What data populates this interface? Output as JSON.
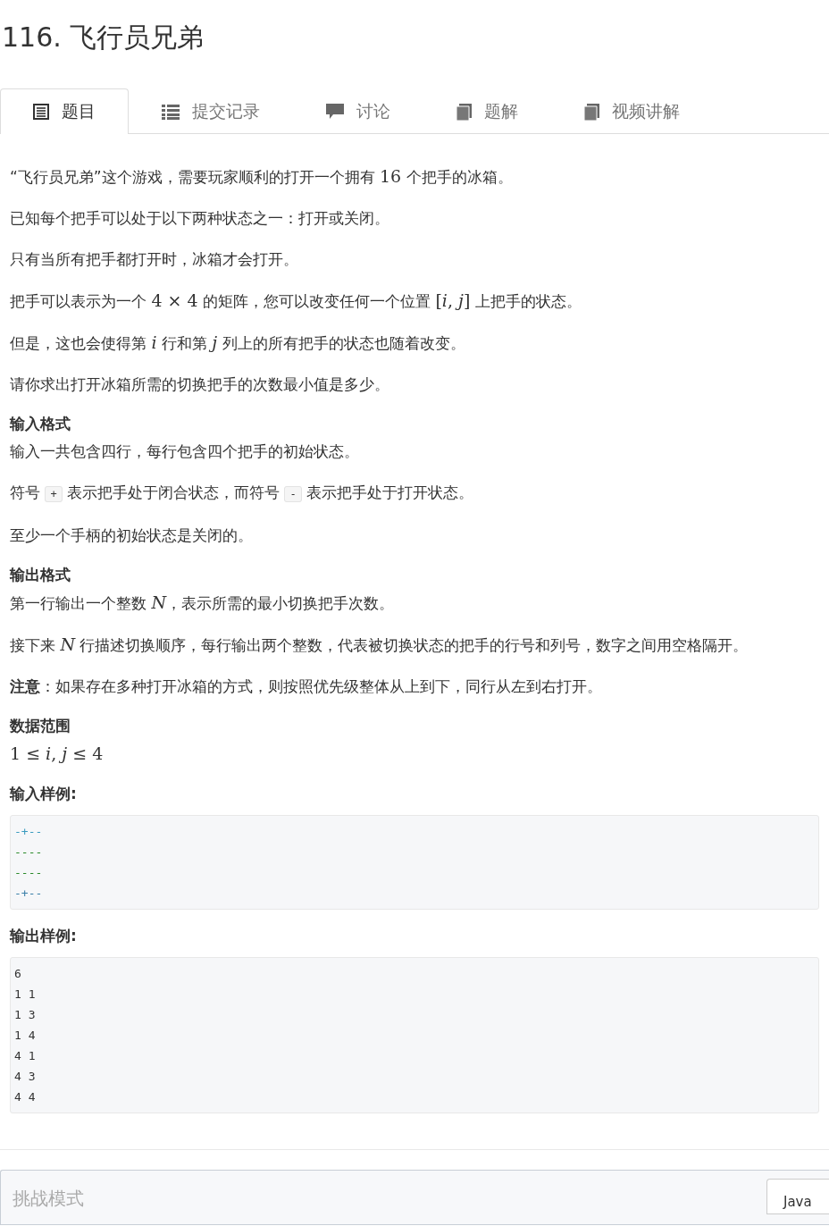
{
  "title": "116. 飞行员兄弟",
  "tabs": [
    {
      "label": "题目",
      "selected": true
    },
    {
      "label": "提交记录",
      "selected": false
    },
    {
      "label": "讨论",
      "selected": false
    },
    {
      "label": "题解",
      "selected": false
    },
    {
      "label": "视频讲解",
      "selected": false
    }
  ],
  "blocks": [
    {
      "kind": "para",
      "segments": [
        {
          "kind": "text",
          "text": "“飞行员兄弟”这个游戏，需要玩家顺利的打开一个拥有 "
        },
        {
          "kind": "math",
          "text": "16"
        },
        {
          "kind": "text",
          "text": " 个把手的冰箱。"
        }
      ]
    },
    {
      "kind": "para",
      "segments": [
        {
          "kind": "text",
          "text": "已知每个把手可以处于以下两种状态之一：打开或关闭。"
        }
      ]
    },
    {
      "kind": "para",
      "segments": [
        {
          "kind": "text",
          "text": "只有当所有把手都打开时，冰箱才会打开。"
        }
      ]
    },
    {
      "kind": "para",
      "segments": [
        {
          "kind": "text",
          "text": "把手可以表示为一个 "
        },
        {
          "kind": "math",
          "text": "4 × 4"
        },
        {
          "kind": "text",
          "text": " 的矩阵，您可以改变任何一个位置 "
        },
        {
          "kind": "math",
          "text": "[*i*, *j*]"
        },
        {
          "kind": "text",
          "text": " 上把手的状态。"
        }
      ]
    },
    {
      "kind": "para",
      "segments": [
        {
          "kind": "text",
          "text": "但是，这也会使得第 "
        },
        {
          "kind": "math",
          "text": "*i*"
        },
        {
          "kind": "text",
          "text": " 行和第 "
        },
        {
          "kind": "math",
          "text": "*j*"
        },
        {
          "kind": "text",
          "text": " 列上的所有把手的状态也随着改变。"
        }
      ]
    },
    {
      "kind": "para",
      "segments": [
        {
          "kind": "text",
          "text": "请你求出打开冰箱所需的切换把手的次数最小值是多少。"
        }
      ]
    },
    {
      "kind": "heading",
      "text": "输入格式"
    },
    {
      "kind": "para",
      "segments": [
        {
          "kind": "text",
          "text": "输入一共包含四行，每行包含四个把手的初始状态。"
        }
      ]
    },
    {
      "kind": "para",
      "segments": [
        {
          "kind": "text",
          "text": "符号 "
        },
        {
          "kind": "code",
          "text": "+"
        },
        {
          "kind": "text",
          "text": " 表示把手处于闭合状态，而符号 "
        },
        {
          "kind": "code",
          "text": "-"
        },
        {
          "kind": "text",
          "text": " 表示把手处于打开状态。"
        }
      ]
    },
    {
      "kind": "para",
      "segments": [
        {
          "kind": "text",
          "text": "至少一个手柄的初始状态是关闭的。"
        }
      ]
    },
    {
      "kind": "heading",
      "text": "输出格式"
    },
    {
      "kind": "para",
      "segments": [
        {
          "kind": "text",
          "text": "第一行输出一个整数 "
        },
        {
          "kind": "math",
          "text": "*N*"
        },
        {
          "kind": "text",
          "text": "，表示所需的最小切换把手次数。"
        }
      ]
    },
    {
      "kind": "para",
      "segments": [
        {
          "kind": "text",
          "text": "接下来 "
        },
        {
          "kind": "math",
          "text": "*N*"
        },
        {
          "kind": "text",
          "text": " 行描述切换顺序，每行输出两个整数，代表被切换状态的把手的行号和列号，数字之间用空格隔开。"
        }
      ]
    },
    {
      "kind": "para",
      "segments": [
        {
          "kind": "text",
          "text": "**注意**：如果存在多种打开冰箱的方式，则按照优先级整体从上到下，同行从左到右打开。"
        }
      ]
    },
    {
      "kind": "heading",
      "text": "数据范围"
    },
    {
      "kind": "para",
      "segments": [
        {
          "kind": "math",
          "text": "1 ≤ *i*, *j* ≤ 4"
        }
      ]
    },
    {
      "kind": "heading",
      "text": "输入样例:"
    },
    {
      "kind": "code_block",
      "lines": [
        {
          "text": "-+--",
          "color": "#3a9bbf"
        },
        {
          "text": "----",
          "color": "#2a8a2a"
        },
        {
          "text": "----",
          "color": "#2a8a2a"
        },
        {
          "text": "-+--",
          "color": "#3a7fa8"
        }
      ]
    },
    {
      "kind": "heading",
      "text": "输出样例:"
    },
    {
      "kind": "code_block",
      "lines": [
        {
          "text": "6"
        },
        {
          "text": "1 1"
        },
        {
          "text": "1 3"
        },
        {
          "text": "1 4"
        },
        {
          "text": "4 1"
        },
        {
          "text": "4 3"
        },
        {
          "text": "4 4"
        }
      ]
    }
  ],
  "editor": {
    "mode_label": "挑战模式",
    "language": "Java"
  }
}
